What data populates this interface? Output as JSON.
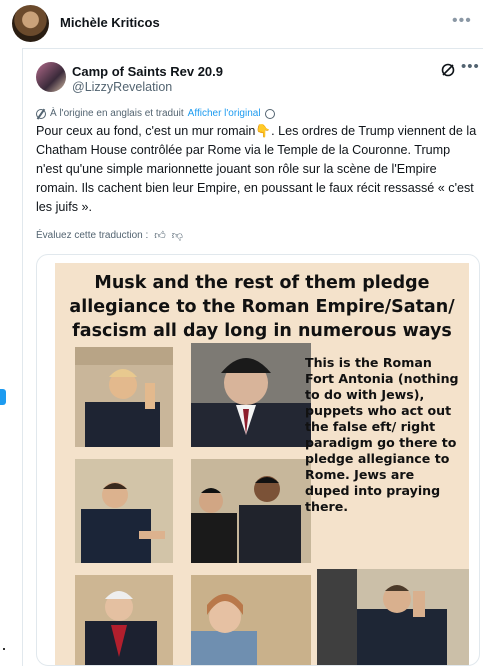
{
  "outer_post": {
    "author_name": "Michèle Kriticos",
    "more_icon": "ellipsis-icon"
  },
  "quoted_post": {
    "author_name": "Camp of Saints Rev 20.9",
    "handle": "@LizzyRevelation",
    "translation_notice": "À l'origine en anglais et traduit",
    "show_original_label": "Afficher l'original",
    "text_part1": "Pour ceux au fond, c'est un mur romain",
    "emoji": "👇",
    "text_part2": ". Les ordres de Trump viennent de la Chatham House contrôlée par Rome via le Temple de la Couronne. Trump n'est qu'une simple marionnette jouant son rôle sur la scène de l'Empire romain. Ils cachent bien leur Empire, en poussant le faux récit ressassé « c'est les juifs ».",
    "rate_translation_label": "Évaluez cette traduction :"
  },
  "media": {
    "poster_title": "Musk and the rest of them pledge allegiance to the Roman Empire/Satan/ fascism all day long in numerous ways",
    "poster_body": "This is the Roman Fort Antonia (nothing to do with Jews), puppets who act out the false eft/ right paradigm go there to pledge allegiance to Rome. Jews are duped into praying there."
  },
  "colors": {
    "accent": "#1d9bf0",
    "poster_bg": "#f4e2cb",
    "muted": "#536471"
  }
}
